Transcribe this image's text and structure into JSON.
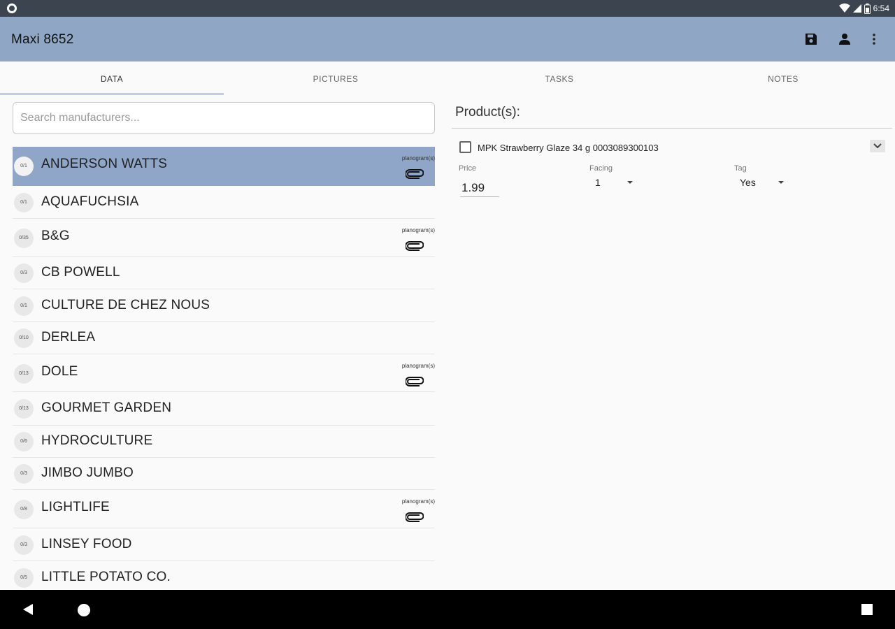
{
  "status_bar": {
    "time": "6:54"
  },
  "app_bar": {
    "title": "Maxi 8652"
  },
  "tabs": [
    {
      "label": "DATA"
    },
    {
      "label": "PICTURES"
    },
    {
      "label": "TASKS"
    },
    {
      "label": "NOTES"
    }
  ],
  "search": {
    "placeholder": "Search manufacturers..."
  },
  "manufacturers": [
    {
      "name": "ANDERSON WATTS",
      "badge": "0/1",
      "planogram": "planogram(s)"
    },
    {
      "name": "AQUAFUCHSIA",
      "badge": "0/1"
    },
    {
      "name": "B&G",
      "badge": "0/35",
      "planogram": "planogram(s)"
    },
    {
      "name": "CB POWELL",
      "badge": "0/3"
    },
    {
      "name": "CULTURE DE CHEZ NOUS",
      "badge": "0/1"
    },
    {
      "name": "DERLEA",
      "badge": "0/10"
    },
    {
      "name": "DOLE",
      "badge": "0/13",
      "planogram": "planogram(s)"
    },
    {
      "name": "GOURMET GARDEN",
      "badge": "0/13"
    },
    {
      "name": "HYDROCULTURE",
      "badge": "0/6"
    },
    {
      "name": "JIMBO JUMBO",
      "badge": "0/3"
    },
    {
      "name": "LIGHTLIFE",
      "badge": "0/8",
      "planogram": "planogram(s)"
    },
    {
      "name": "LINSEY  FOOD",
      "badge": "0/3"
    },
    {
      "name": "LITTLE POTATO CO.",
      "badge": "0/5"
    }
  ],
  "products": {
    "title": "Product(s):",
    "items": [
      {
        "label": "MPK Strawberry Glaze 34 g 0003089300103",
        "price_label": "Price",
        "price_value": "1.99",
        "facing_label": "Facing",
        "facing_value": "1",
        "tag_label": "Tag",
        "tag_value": "Yes"
      }
    ]
  }
}
